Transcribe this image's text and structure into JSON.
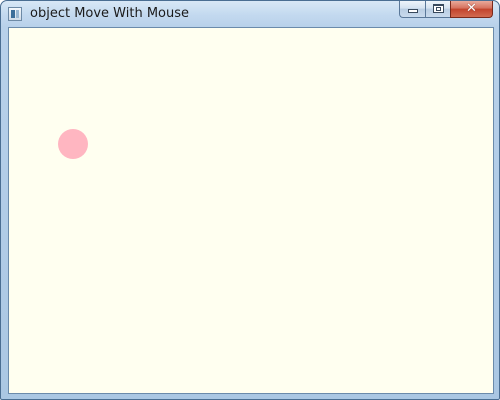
{
  "window": {
    "title": "object Move With Mouse",
    "icon": "application-window-icon"
  },
  "caption_buttons": {
    "minimize_icon": "minimize-icon",
    "maximize_icon": "restore-icon",
    "close_glyph": "✕"
  },
  "canvas": {
    "background_color": "#fffff0",
    "object": {
      "shape": "circle",
      "color": "#ffb6c1"
    }
  }
}
